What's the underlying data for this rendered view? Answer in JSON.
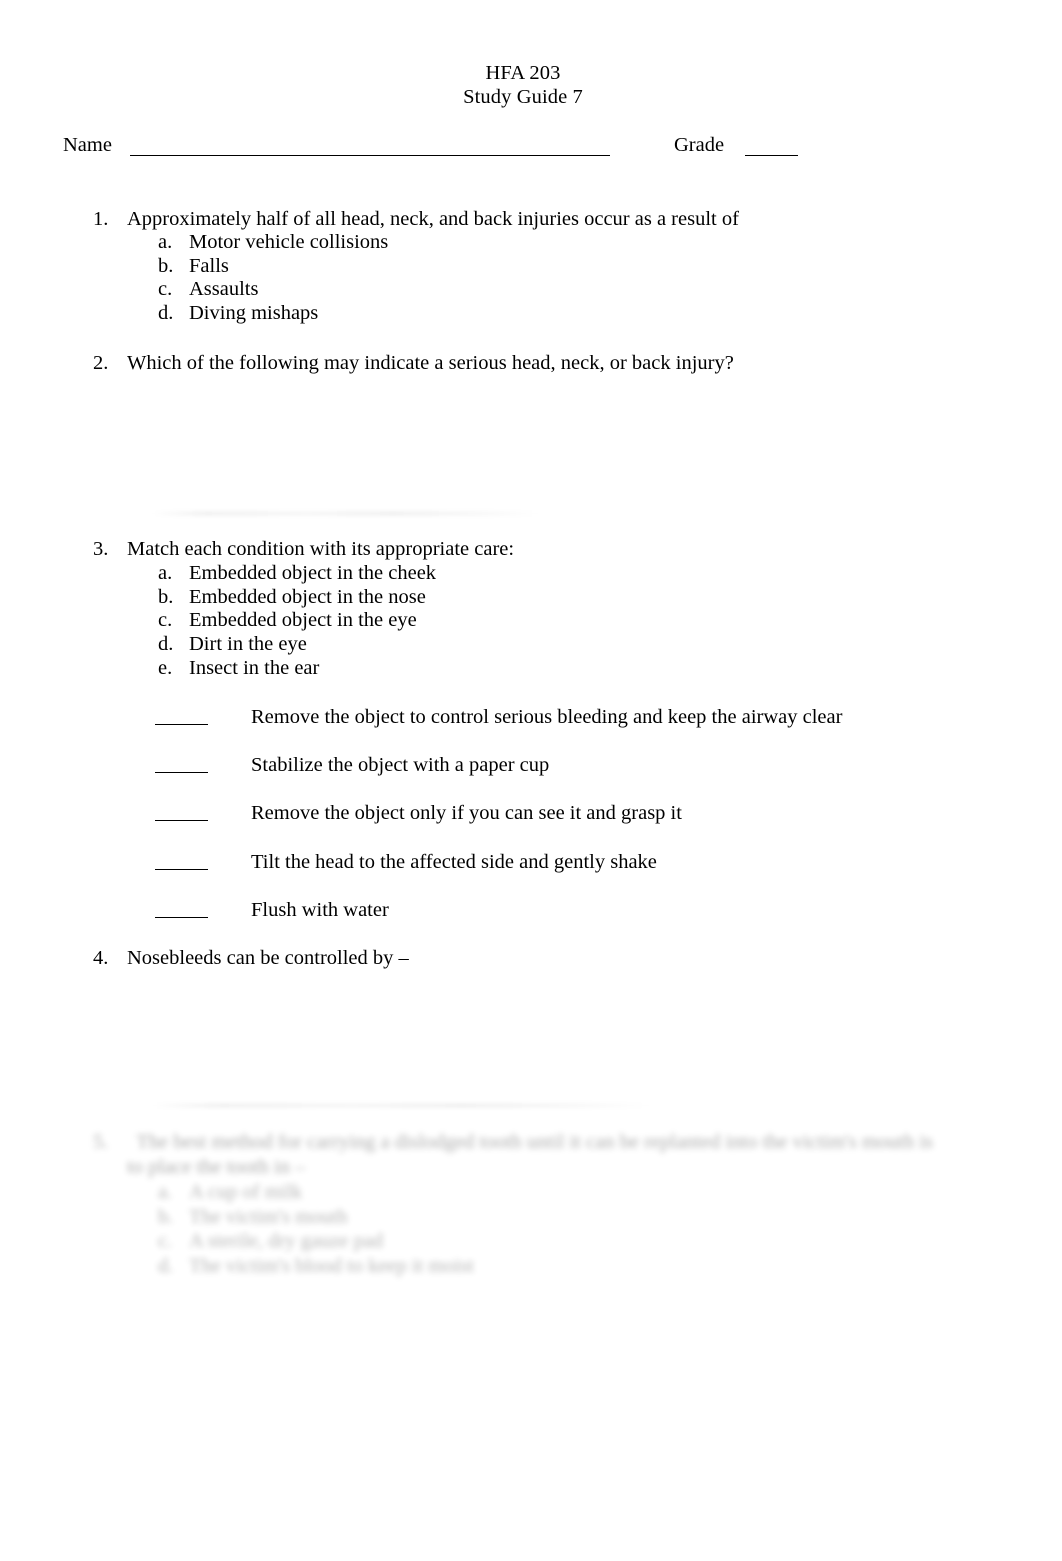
{
  "document": {
    "title_line1": "HFA 203",
    "title_line2": "Study Guide 7"
  },
  "header_fields": {
    "name_label": "Name",
    "name_value": "",
    "grade_label": "Grade",
    "grade_value": ""
  },
  "questions": [
    {
      "number": "1.",
      "text": "Approximately half of all head, neck, and back injuries occur as a result of",
      "options": [
        {
          "letter": "a.",
          "text": "Motor vehicle collisions"
        },
        {
          "letter": "b.",
          "text": "Falls"
        },
        {
          "letter": "c.",
          "text": "Assaults"
        },
        {
          "letter": "d.",
          "text": "Diving mishaps"
        }
      ]
    },
    {
      "number": "2.",
      "text": "Which of the following may indicate a serious head, neck, or back injury?",
      "options": []
    },
    {
      "number": "3.",
      "text": "Match each condition with its appropriate care:",
      "options": [
        {
          "letter": "a.",
          "text": "Embedded object in the cheek"
        },
        {
          "letter": "b.",
          "text": "Embedded object in the nose"
        },
        {
          "letter": "c.",
          "text": "Embedded object in the eye"
        },
        {
          "letter": "d.",
          "text": "Dirt in the eye"
        },
        {
          "letter": "e.",
          "text": "Insect in the ear"
        }
      ]
    },
    {
      "number": "4.",
      "text": "Nosebleeds can be controlled by –",
      "options": []
    }
  ],
  "matching_answers": [
    {
      "blank": "",
      "text": "Remove the object to control serious bleeding and keep the airway clear"
    },
    {
      "blank": "",
      "text": "Stabilize the object with a paper cup"
    },
    {
      "blank": "",
      "text": "Remove the object only if you can see it and grasp it"
    },
    {
      "blank": "",
      "text": "Tilt the head to the affected side and gently shake"
    },
    {
      "blank": "",
      "text": "Flush with water"
    }
  ],
  "faded_question": {
    "number": "5.",
    "line1": "The best method for carrying a dislodged tooth until it can be replanted into the victim's mouth is",
    "line2": "to place the tooth in –",
    "options": [
      {
        "letter": "a.",
        "text": "A cup of milk"
      },
      {
        "letter": "b.",
        "text": "The victim's mouth"
      },
      {
        "letter": "c.",
        "text": "A sterile, dry gauze pad"
      },
      {
        "letter": "d.",
        "text": "The victim's blood to keep it moist"
      }
    ]
  }
}
